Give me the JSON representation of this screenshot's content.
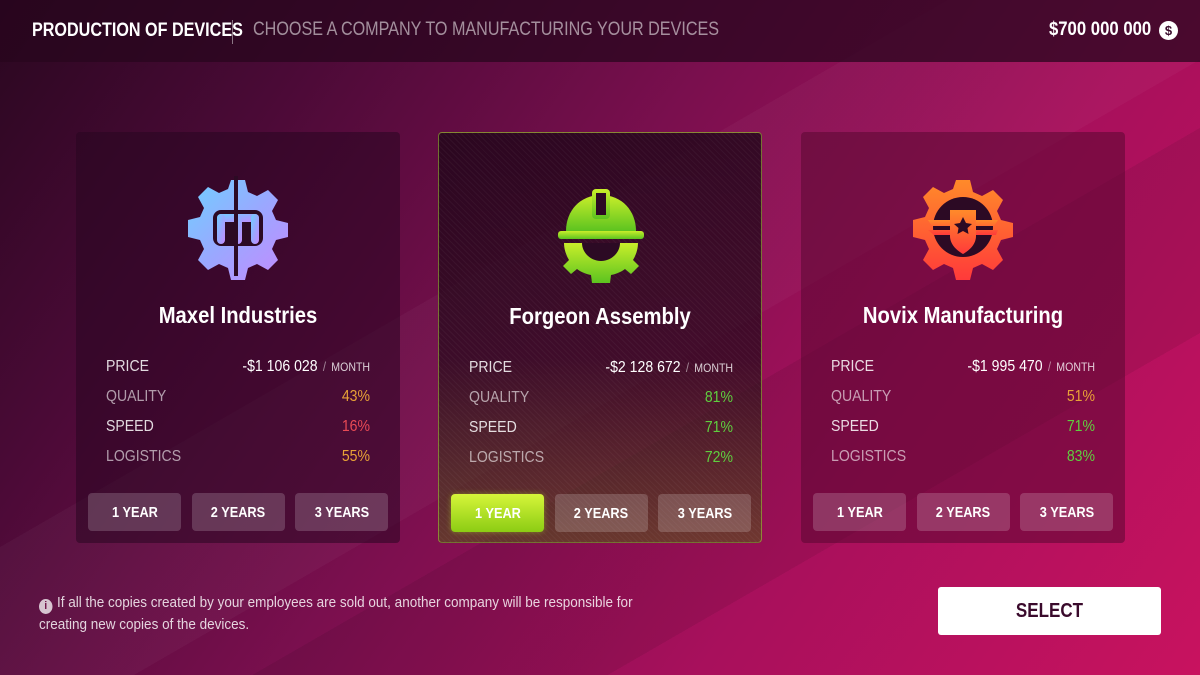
{
  "header": {
    "title": "PRODUCTION OF DEVICES",
    "subtitle": "CHOOSE A COMPANY TO MANUFACTURING YOUR DEVICES",
    "money": "$700 000 000",
    "currency_symbol": "$"
  },
  "labels": {
    "price": "PRICE",
    "quality": "QUALITY",
    "speed": "SPEED",
    "logistics": "LOGISTICS",
    "per": "/",
    "month": "MONTH"
  },
  "colors": {
    "good": "#5fcf3f",
    "medium": "#e8a237",
    "bad": "#e84a55",
    "selected_button": "#b4e52a"
  },
  "companies": [
    {
      "name": "Maxel Industries",
      "logo_icon": "gear-m-icon",
      "price": "-$1 106 028",
      "quality": "43%",
      "speed": "16%",
      "logistics": "55%",
      "years": [
        "1 YEAR",
        "2 YEARS",
        "3 YEARS"
      ],
      "selected_term": "none"
    },
    {
      "name": "Forgeon Assembly",
      "logo_icon": "hardhat-gear-icon",
      "price": "-$2 128 672",
      "quality": "81%",
      "speed": "71%",
      "logistics": "72%",
      "years": [
        "1 YEAR",
        "2 YEARS",
        "3 YEARS"
      ],
      "selected_term": "1 YEAR"
    },
    {
      "name": "Novix Manufacturing",
      "logo_icon": "shield-gear-icon",
      "price": "-$1 995 470",
      "quality": "51%",
      "speed": "71%",
      "logistics": "83%",
      "years": [
        "1 YEAR",
        "2 YEARS",
        "3 YEARS"
      ],
      "selected_term": "none"
    }
  ],
  "footer": {
    "info_icon": "info-icon",
    "info_line1": "If all the copies created by your employees are sold out, another company will be responsible for",
    "info_line2": "creating new copies of the devices.",
    "select_label": "SELECT"
  }
}
